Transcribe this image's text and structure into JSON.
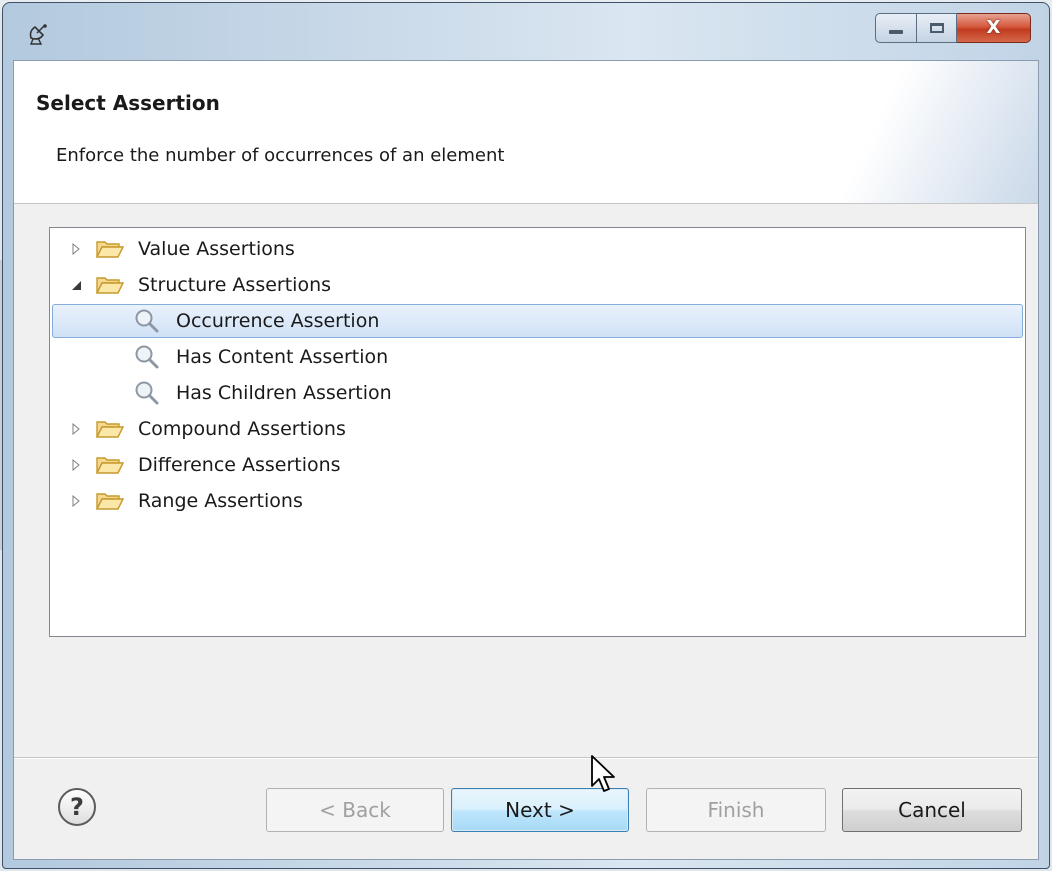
{
  "window": {
    "icon": "satellite-dish-icon",
    "controls": {
      "minimize": "minimize-icon",
      "maximize": "maximize-icon",
      "close": "close-icon",
      "close_glyph": "X"
    }
  },
  "header": {
    "title": "Select Assertion",
    "description": "Enforce the number of occurrences of an element"
  },
  "tree": {
    "items": [
      {
        "label": "Value Assertions",
        "type": "folder",
        "expanded": false,
        "level": 0
      },
      {
        "label": "Structure Assertions",
        "type": "folder",
        "expanded": true,
        "level": 0
      },
      {
        "label": "Occurrence Assertion",
        "type": "assertion",
        "level": 1,
        "selected": true
      },
      {
        "label": "Has Content Assertion",
        "type": "assertion",
        "level": 1
      },
      {
        "label": "Has Children Assertion",
        "type": "assertion",
        "level": 1
      },
      {
        "label": "Compound Assertions",
        "type": "folder",
        "expanded": false,
        "level": 0
      },
      {
        "label": "Difference Assertions",
        "type": "folder",
        "expanded": false,
        "level": 0
      },
      {
        "label": "Range Assertions",
        "type": "folder",
        "expanded": false,
        "level": 0
      }
    ]
  },
  "buttons": {
    "help": "?",
    "back": "< Back",
    "next": "Next >",
    "finish": "Finish",
    "cancel": "Cancel"
  },
  "colors": {
    "selection_border": "#84acdd",
    "default_button_border": "#3c7fb1",
    "close_button": "#c13b1f"
  }
}
